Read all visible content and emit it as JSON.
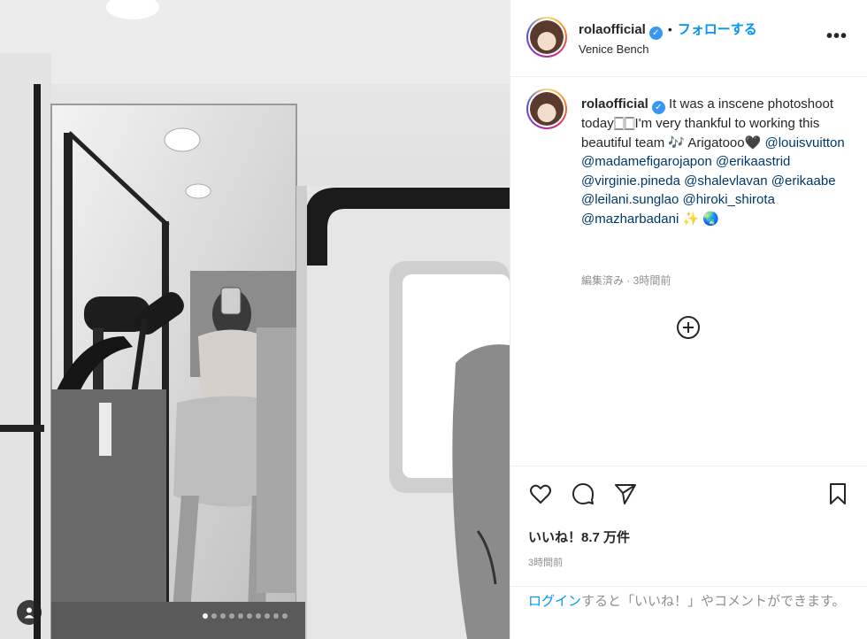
{
  "post": {
    "username": "rolaofficial",
    "verified_mark": "✓",
    "separator": "•",
    "follow_label": "フォローする",
    "location": "Venice Bench",
    "more_label": "•••"
  },
  "caption": {
    "username": "rolaofficial",
    "text_1": "It was a inscene photoshoot today🀆🀆I'm very thankful to working this beautiful team 🎶 Arigatooo🖤 ",
    "mentions": [
      "@louisvuitton",
      "@madamefigarojapon",
      "@erikaastrid",
      "@virginie.pineda",
      "@shalevlavan",
      "@erikaabe",
      "@leilani.sunglao",
      "@hiroki_shirota",
      "@mazharbadani"
    ],
    "tail_emoji": " ✨ 🌏",
    "meta": "編集済み · 3時間前"
  },
  "actions": {
    "likes": "いいね！8.7 万件",
    "time": "3時間前"
  },
  "footer": {
    "login_link": "ログイン",
    "rest": "すると「いいね！」やコメントができます。"
  },
  "carousel": {
    "slide_count": 10,
    "active_index": 0
  },
  "colors": {
    "accent": "#0095f6",
    "verified": "#3897f0",
    "mention": "#00376b",
    "muted": "#8e8e8e"
  }
}
